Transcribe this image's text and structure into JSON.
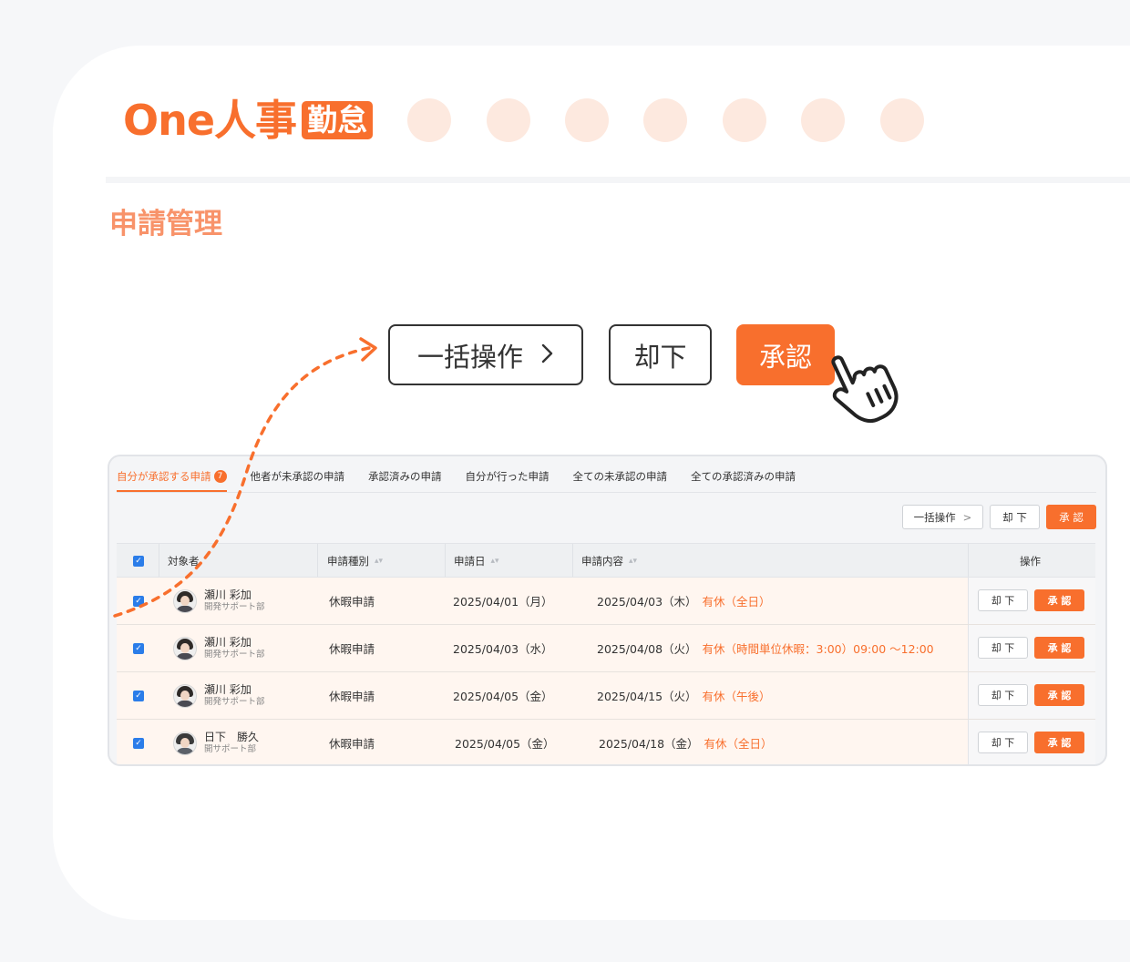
{
  "brand": {
    "name": "One人事",
    "badge": "勤怠",
    "primary_color": "#f86f2d",
    "title_color": "#f8936a",
    "dot_color": "#fde9df"
  },
  "page": {
    "title": "申請管理"
  },
  "action_bar": {
    "bulk_label": "一括操作",
    "bulk_icon": "chevron-right-icon",
    "reject_label": "却下",
    "approve_label": "承認",
    "cursor_icon": "pointing-hand-cursor-icon"
  },
  "tabs": [
    {
      "label": "自分が承認する申請",
      "badge": "7",
      "active": true
    },
    {
      "label": "他者が未承認の申請"
    },
    {
      "label": "承認済みの申請"
    },
    {
      "label": "自分が行った申請"
    },
    {
      "label": "全ての未承認の申請"
    },
    {
      "label": "全ての承認済みの申請"
    }
  ],
  "toolbar": {
    "bulk_label": "一括操作",
    "reject_label": "却 下",
    "approve_label": "承 認"
  },
  "table": {
    "headers": {
      "subject": "対象者",
      "type": "申請種別",
      "date": "申請日",
      "content": "申請内容",
      "ops": "操作"
    },
    "rows": [
      {
        "name": "瀬川 彩加",
        "dept": "開発サポート部",
        "type": "休暇申請",
        "date": "2025/04/01（月）",
        "content_date": "2025/04/03（木）",
        "leave": "有休（全日）",
        "checked": true
      },
      {
        "name": "瀬川 彩加",
        "dept": "開発サポート部",
        "type": "休暇申請",
        "date": "2025/04/03（水）",
        "content_date": "2025/04/08（火）",
        "leave": "有休（時間単位休暇：3:00）09:00 〜12:00",
        "checked": true
      },
      {
        "name": "瀬川 彩加",
        "dept": "開発サポート部",
        "type": "休暇申請",
        "date": "2025/04/05（金）",
        "content_date": "2025/04/15（火）",
        "leave": "有休（午後）",
        "checked": true
      },
      {
        "name": "日下　勝久",
        "dept": "開サポート部",
        "type": "休暇申請",
        "date": "2025/04/05（金）",
        "content_date": "2025/04/18（金）",
        "leave": "有休（全日）",
        "checked": true
      }
    ],
    "row_reject_label": "却 下",
    "row_approve_label": "承 認"
  }
}
